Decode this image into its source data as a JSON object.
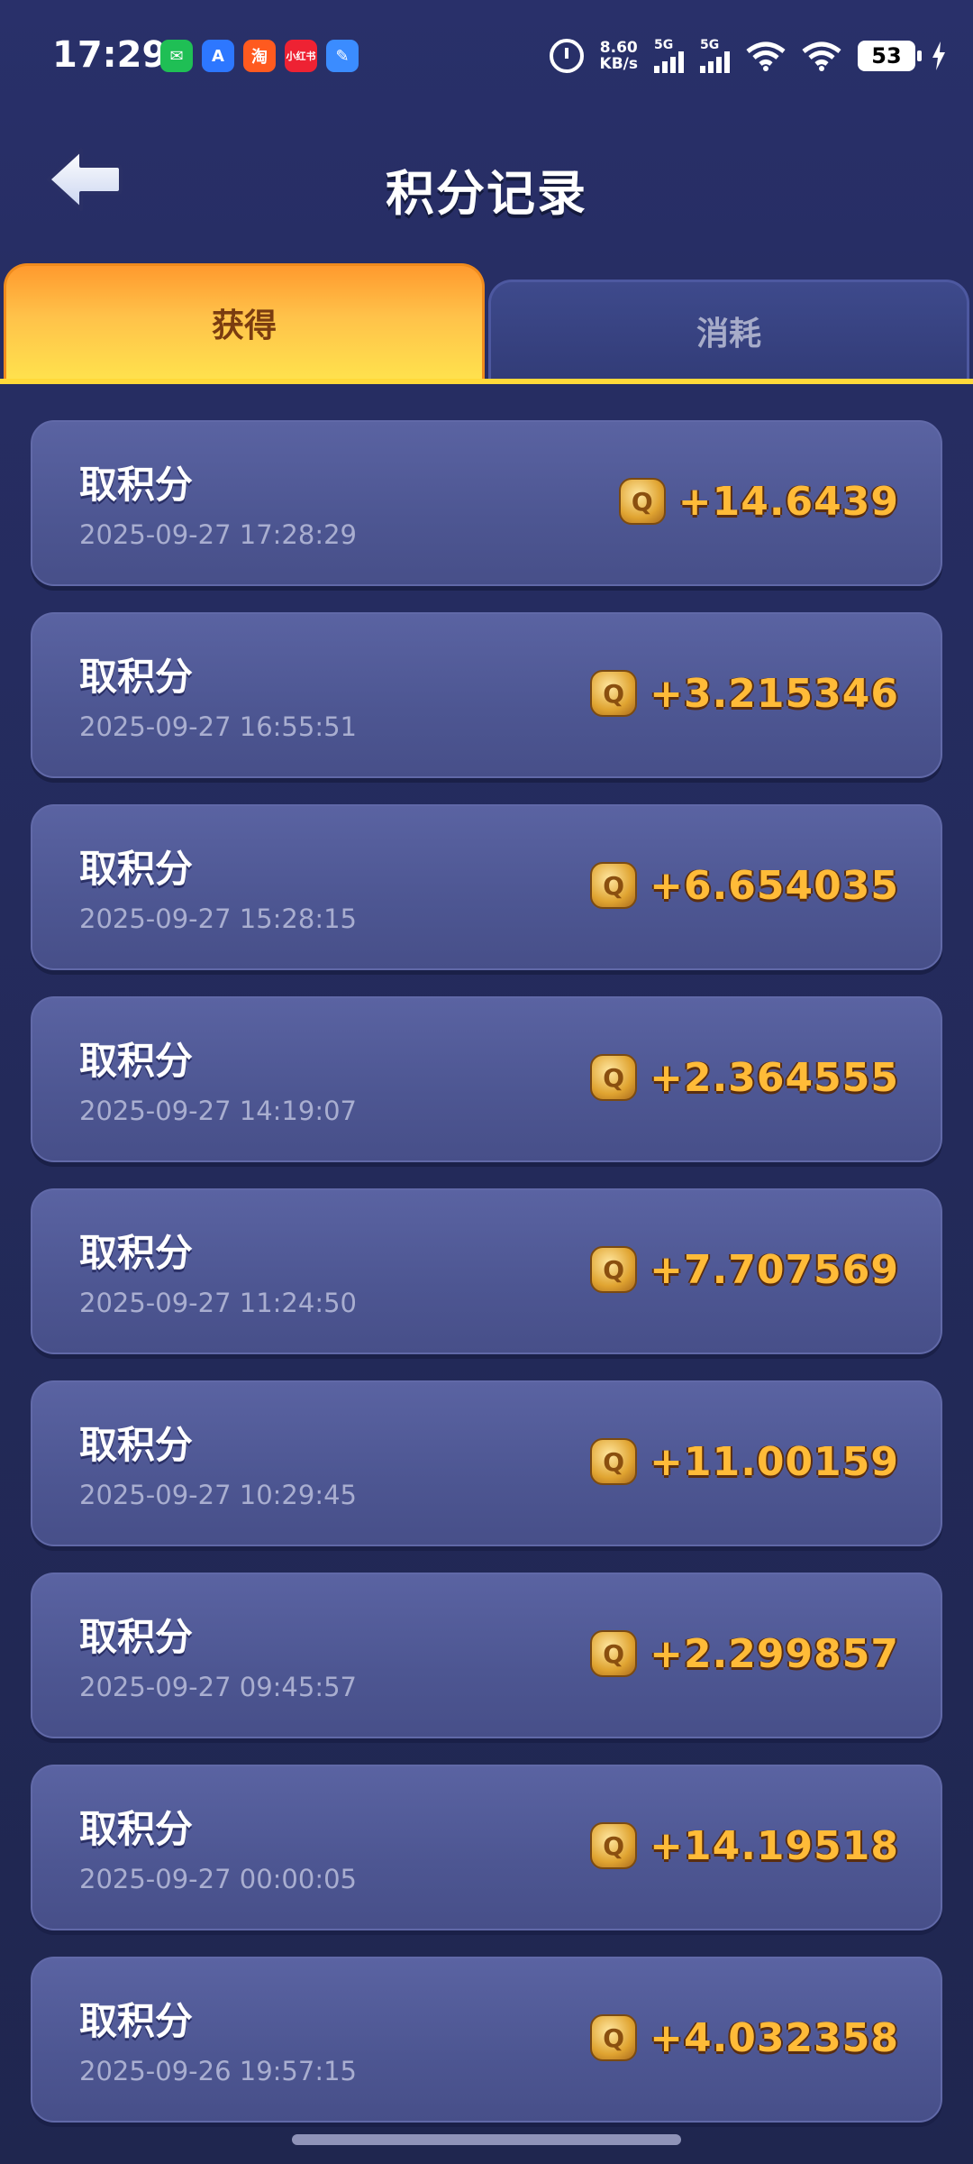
{
  "status_bar": {
    "time": "17:29",
    "net_speed_value": "8.60",
    "net_speed_unit": "KB/s",
    "sim1_label": "5G",
    "sim2_label": "5G",
    "battery": "53",
    "notification_icons": [
      "wechat-icon",
      "app-store-icon",
      "taobao-icon",
      "xiaohongshu-icon",
      "app-icon"
    ],
    "notif_labels": {
      "wechat": "✉",
      "app": "A",
      "taobao": "淘",
      "red": "小红书",
      "blue": "✎"
    }
  },
  "header": {
    "title": "积分记录",
    "back_icon": "back-arrow-icon"
  },
  "tabs": [
    {
      "label": "获得",
      "active": true
    },
    {
      "label": "消耗",
      "active": false
    }
  ],
  "records": [
    {
      "title": "取积分",
      "time": "2025-09-27 17:28:29",
      "amount": "+14.6439"
    },
    {
      "title": "取积分",
      "time": "2025-09-27 16:55:51",
      "amount": "+3.215346"
    },
    {
      "title": "取积分",
      "time": "2025-09-27 15:28:15",
      "amount": "+6.654035"
    },
    {
      "title": "取积分",
      "time": "2025-09-27 14:19:07",
      "amount": "+2.364555"
    },
    {
      "title": "取积分",
      "time": "2025-09-27 11:24:50",
      "amount": "+7.707569"
    },
    {
      "title": "取积分",
      "time": "2025-09-27 10:29:45",
      "amount": "+11.00159"
    },
    {
      "title": "取积分",
      "time": "2025-09-27 09:45:57",
      "amount": "+2.299857"
    },
    {
      "title": "取积分",
      "time": "2025-09-27 00:00:05",
      "amount": "+14.19518"
    },
    {
      "title": "取积分",
      "time": "2025-09-26 19:57:15",
      "amount": "+4.032358"
    }
  ],
  "coin_glyph": "Q",
  "colors": {
    "background": "#262d62",
    "card": "#525b9a",
    "amount": "#ffbb38",
    "active_tab": "#ffc24a",
    "tab_underline": "#ffd93a"
  }
}
